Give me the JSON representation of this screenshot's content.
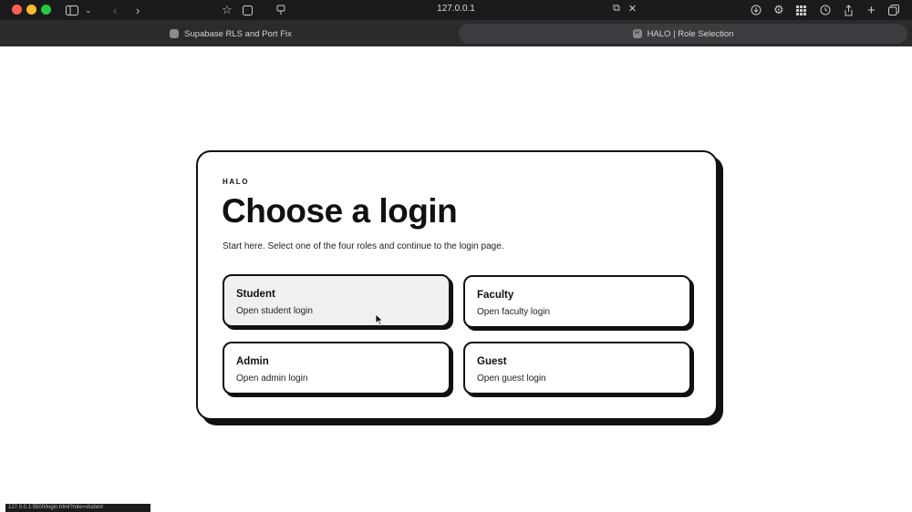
{
  "browser": {
    "url": "127.0.0.1",
    "tabs": [
      {
        "label": "Supabase RLS and Port Fix",
        "active": false
      },
      {
        "label": "HALO | Role Selection",
        "active": true
      }
    ],
    "status_url": "127.0.0.1:5500/login.html?role=student"
  },
  "page": {
    "brand": "HALO",
    "title": "Choose a login",
    "subtitle": "Start here. Select one of the four roles and continue to the login page.",
    "roles": [
      {
        "title": "Student",
        "description": "Open student login"
      },
      {
        "title": "Faculty",
        "description": "Open faculty login"
      },
      {
        "title": "Admin",
        "description": "Open admin login"
      },
      {
        "title": "Guest",
        "description": "Open guest login"
      }
    ]
  },
  "colors": {
    "ink": "#111111",
    "hover_fill": "#f0f0f1",
    "chrome_dark": "#1b1b1d"
  }
}
